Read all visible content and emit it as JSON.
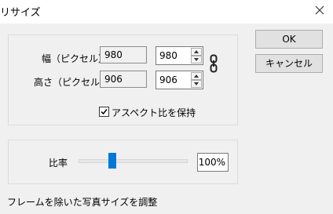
{
  "window": {
    "title": "リサイズ"
  },
  "size": {
    "width_label": "幅（ピクセル）",
    "width_original": "980",
    "width_value": "980",
    "height_label": "高さ（ピクセル）",
    "height_original": "906",
    "height_value": "906"
  },
  "keep_aspect": {
    "label": "アスペクト比を保持",
    "checked": true
  },
  "ratio": {
    "label": "比率",
    "value": "100%"
  },
  "buttons": {
    "ok": "OK",
    "cancel": "キャンセル"
  },
  "footer": {
    "text": "フレームを除いた写真サイズを調整"
  }
}
